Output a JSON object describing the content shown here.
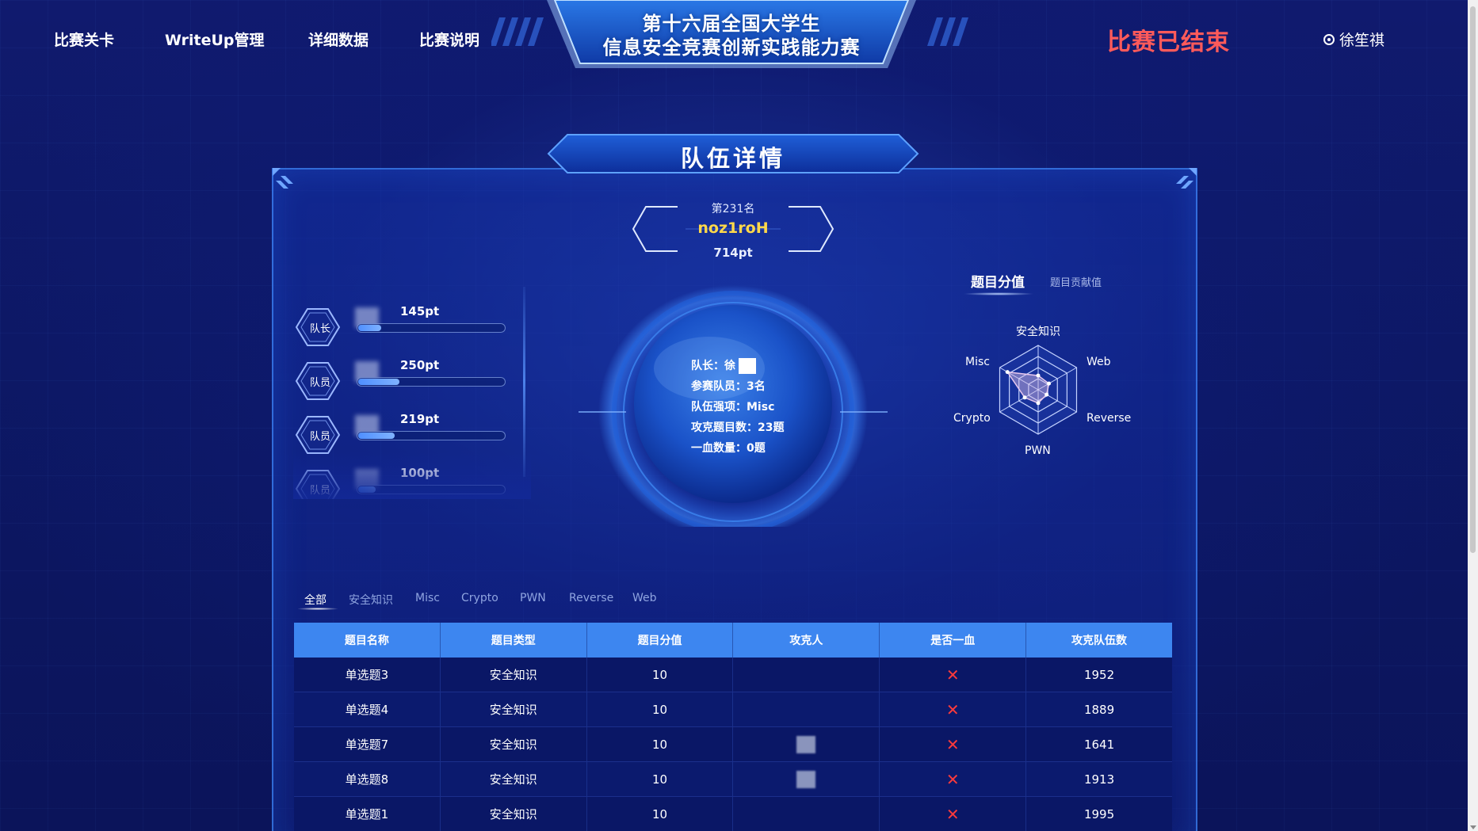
{
  "nav": {
    "items": [
      {
        "label": "比赛关卡"
      },
      {
        "label": "WriteUp管理"
      },
      {
        "label": "详细数据"
      },
      {
        "label": "比赛说明"
      }
    ],
    "title_line1": "第十六届全国大学生",
    "title_line2": "信息安全竞赛创新实践能力赛",
    "status": "比赛已结束",
    "user_name": "徐笙祺",
    "user_icon": "radio-user-icon"
  },
  "panel": {
    "title": "队伍详情"
  },
  "team": {
    "rank": "第231名",
    "name": "noz1roH",
    "score": "714pt"
  },
  "members": [
    {
      "role": "队长",
      "name_prefix": "徐",
      "score": "145pt",
      "progress": 0.16
    },
    {
      "role": "队员",
      "name_prefix": "",
      "score": "250pt",
      "progress": 0.28
    },
    {
      "role": "队员",
      "name_prefix": "",
      "score": "219pt",
      "progress": 0.25
    },
    {
      "role": "队员",
      "name_prefix": "",
      "score": "100pt",
      "progress": 0.12
    }
  ],
  "globe_info": {
    "captain_label": "队长：徐",
    "member_count": "参赛队员：3名",
    "strength": "队伍强项：Misc",
    "solved": "攻克题目数：23题",
    "first_blood": "一血数量：0题"
  },
  "radar": {
    "tab_active": "题目分值",
    "tab_inactive": "题目贡献值",
    "axes": [
      "安全知识",
      "Web",
      "Reverse",
      "PWN",
      "Crypto",
      "Misc"
    ],
    "values": [
      0.32,
      0.28,
      0.22,
      0.3,
      0.35,
      0.8
    ]
  },
  "category_tabs": [
    "全部",
    "安全知识",
    "Misc",
    "Crypto",
    "PWN",
    "Reverse",
    "Web"
  ],
  "table": {
    "headers": [
      "题目名称",
      "题目类型",
      "题目分值",
      "攻克人",
      "是否一血",
      "攻克队伍数"
    ],
    "rows": [
      {
        "name": "单选题3",
        "type": "安全知识",
        "score": "10",
        "first_blood": "✕",
        "solves": "1952"
      },
      {
        "name": "单选题4",
        "type": "安全知识",
        "score": "10",
        "first_blood": "✕",
        "solves": "1889"
      },
      {
        "name": "单选题7",
        "type": "安全知识",
        "score": "10",
        "first_blood": "✕",
        "solves": "1641"
      },
      {
        "name": "单选题8",
        "type": "安全知识",
        "score": "10",
        "first_blood": "✕",
        "solves": "1913"
      },
      {
        "name": "单选题1",
        "type": "安全知识",
        "score": "10",
        "first_blood": "✕",
        "solves": "1995"
      }
    ]
  }
}
